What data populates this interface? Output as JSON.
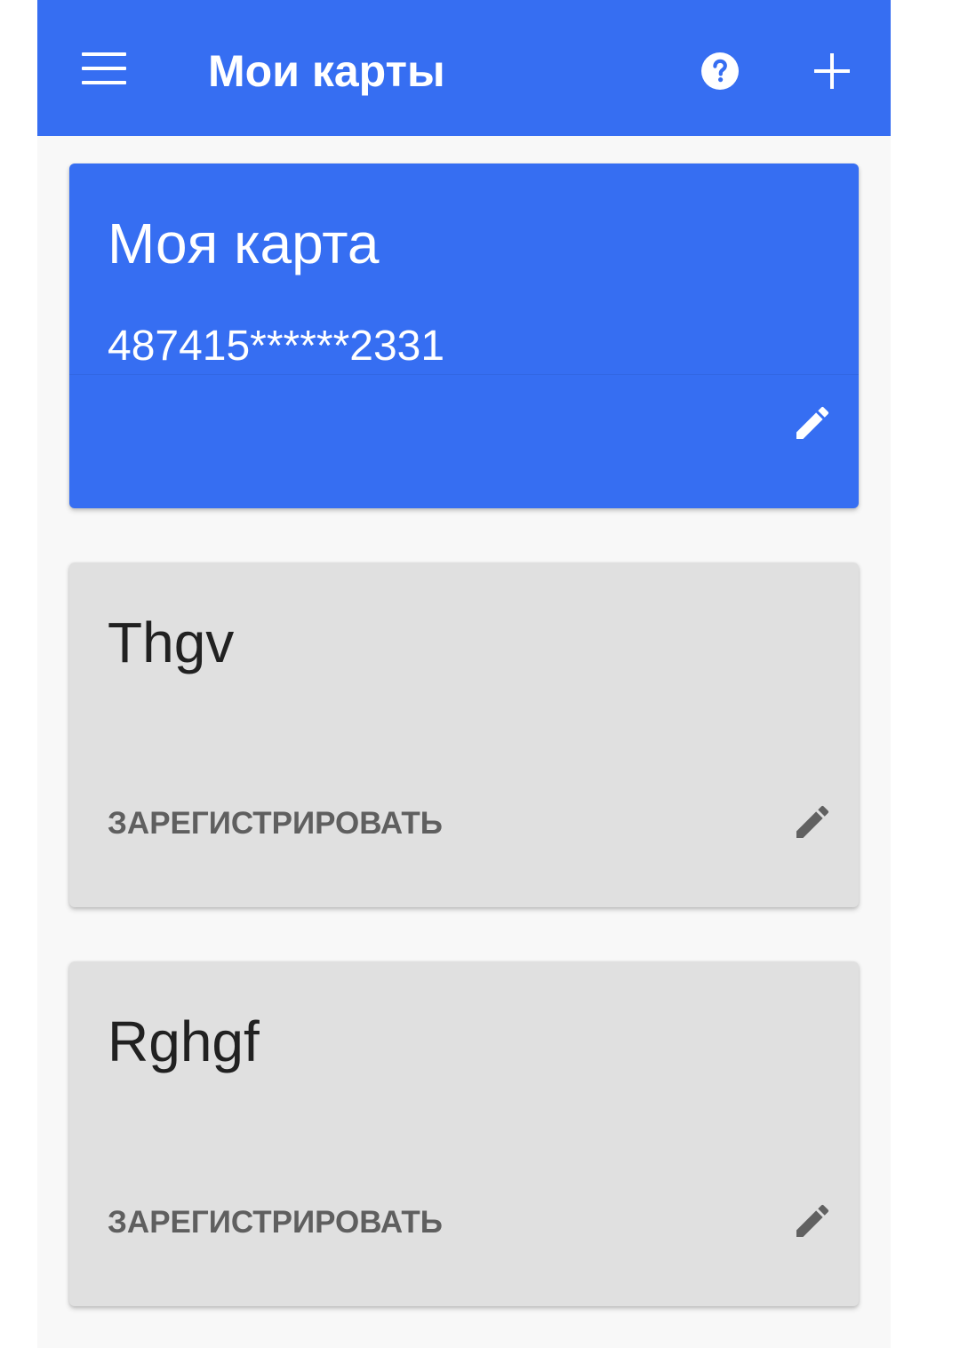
{
  "app_bar": {
    "title": "Мои карты",
    "menu_icon": "menu-icon",
    "help_icon": "help-circle-icon",
    "add_icon": "plus-icon",
    "background_color": "#366ef2"
  },
  "cards": [
    {
      "title": "Моя карта",
      "number": "487415******2331",
      "edit_icon": "pencil-icon",
      "color": "#366ef2"
    },
    {
      "title": "Thgv",
      "action_label": "ЗАРЕГИСТРИРОВАТЬ",
      "edit_icon": "pencil-icon",
      "color": "#e0e0e0"
    },
    {
      "title": "Rghgf",
      "action_label": "ЗАРЕГИСТРИРОВАТЬ",
      "edit_icon": "pencil-icon",
      "color": "#e0e0e0"
    }
  ]
}
